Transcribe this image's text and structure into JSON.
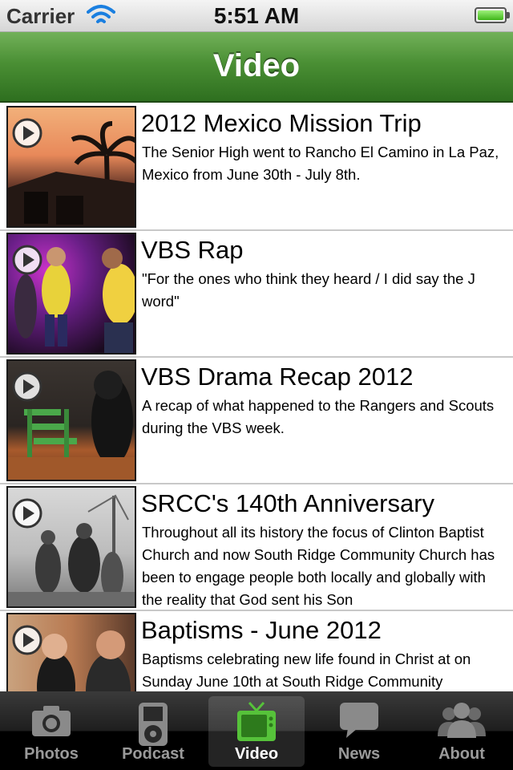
{
  "status_bar": {
    "carrier": "Carrier",
    "time": "5:51 AM"
  },
  "nav": {
    "title": "Video"
  },
  "videos": [
    {
      "title": "2012 Mexico Mission Trip",
      "description": "The Senior High went to Rancho El Camino in La Paz, Mexico from June 30th - July 8th."
    },
    {
      "title": "VBS Rap",
      "description": "\"For the ones who think they heard / I did say the J word\""
    },
    {
      "title": "VBS Drama Recap 2012",
      "description": "A recap of what happened to the Rangers and Scouts during the VBS week."
    },
    {
      "title": "SRCC's 140th Anniversary",
      "description": "Throughout all its history the focus of Clinton Baptist Church and now South Ridge Community Church has been to engage people both locally and globally with the reality that God sent his Son"
    },
    {
      "title": "Baptisms - June 2012",
      "description": "Baptisms celebrating new life found in Christ at on Sunday June 10th at South Ridge Community"
    }
  ],
  "tabs": [
    {
      "label": "Photos",
      "icon": "camera-icon"
    },
    {
      "label": "Podcast",
      "icon": "ipod-icon"
    },
    {
      "label": "Video",
      "icon": "tv-icon"
    },
    {
      "label": "News",
      "icon": "speech-bubble-icon"
    },
    {
      "label": "About",
      "icon": "people-icon"
    }
  ],
  "active_tab": "Video",
  "colors": {
    "nav_green": "#4a8f34",
    "active_tab_green": "#56c23a"
  }
}
